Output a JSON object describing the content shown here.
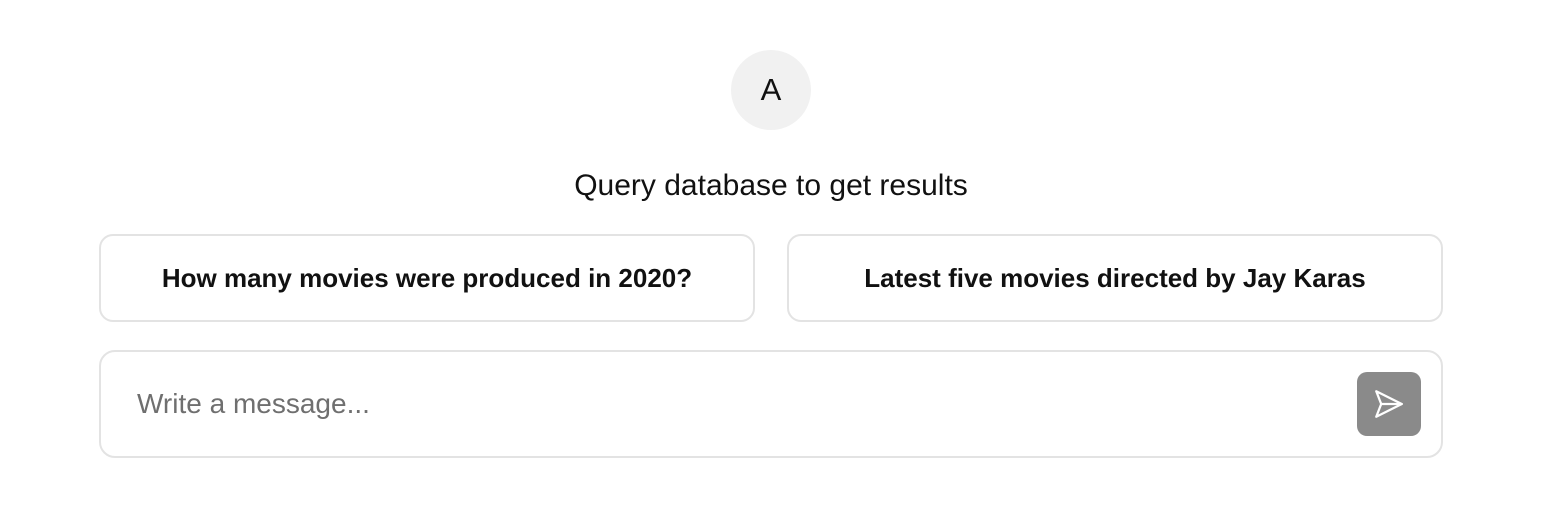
{
  "assistant": {
    "avatar_letter": "A"
  },
  "headline": "Query database to get results",
  "suggestions": [
    {
      "label": "How many movies were produced in 2020?"
    },
    {
      "label": "Latest five movies directed by Jay Karas"
    }
  ],
  "composer": {
    "placeholder": "Write a message...",
    "value": "",
    "send_icon": "send-icon"
  },
  "colors": {
    "avatar_bg": "#f1f1f1",
    "border": "#e3e3e3",
    "send_button_bg": "#8a8a8a",
    "placeholder": "#6f6f6f"
  }
}
